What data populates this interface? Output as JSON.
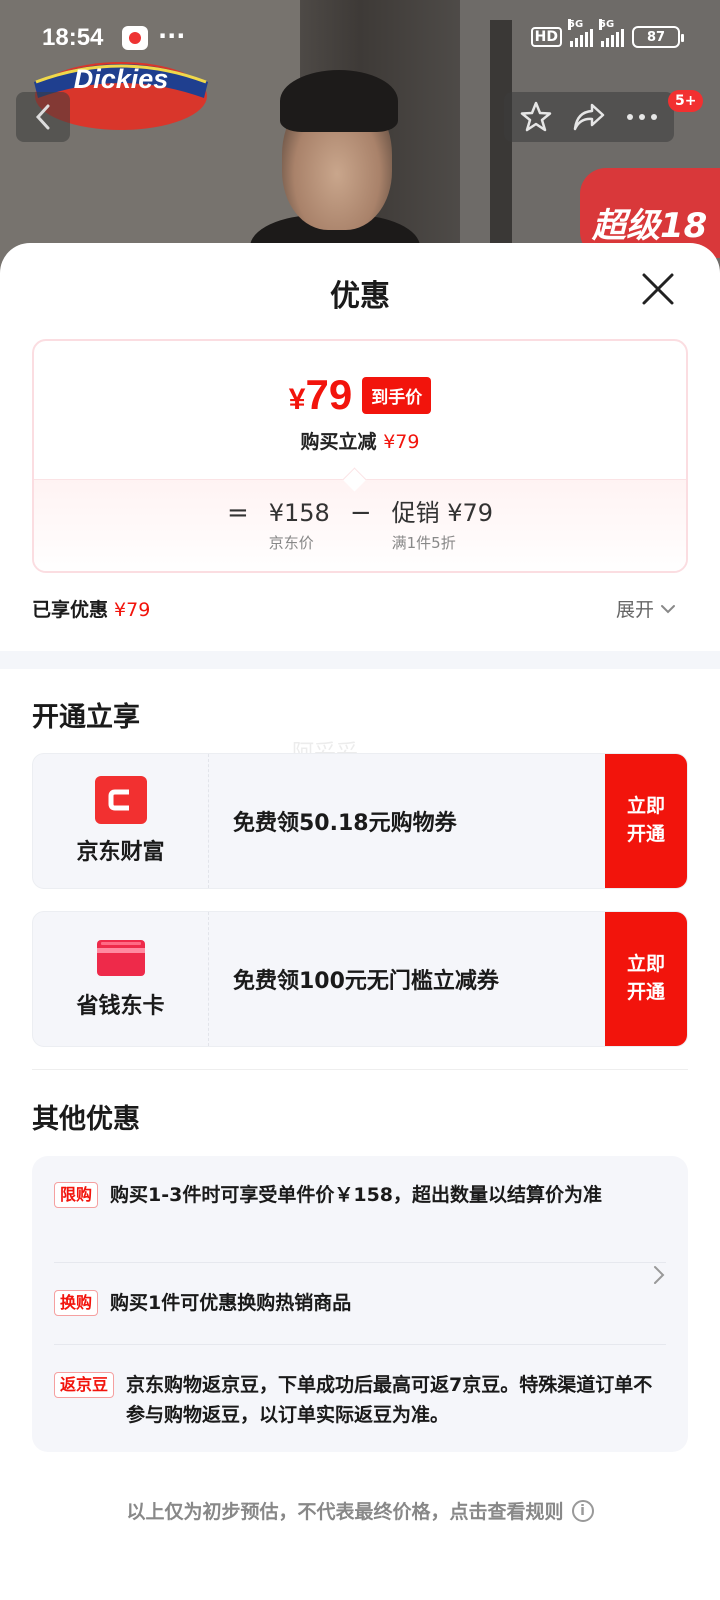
{
  "status_bar": {
    "time": "18:54",
    "dots": "···",
    "hd": "HD",
    "network_1": "5G",
    "network_2": "5G",
    "battery": "87"
  },
  "backdrop": {
    "brand_logo": "Dickies",
    "notification_badge": "5+",
    "promo_tag": "超级18"
  },
  "sheet": {
    "title": "优惠",
    "price_card": {
      "currency": "¥",
      "final_price": "79",
      "final_tag": "到手价",
      "sub_label": "购买立减",
      "sub_amount": "¥79",
      "equals": "=",
      "minus": "−",
      "base_value": "¥158",
      "base_caption": "京东价",
      "promo_value": "促销 ¥79",
      "promo_caption": "满1件5折"
    },
    "enjoyed_label": "已享优惠",
    "enjoyed_amount": "¥79",
    "expand_label": "展开",
    "watermark": "阿妥妥",
    "open_section": {
      "title": "开通立享",
      "cards": [
        {
          "name": "京东财富",
          "text": "免费领50.18元购物券",
          "button": "立即\n开通",
          "icon": "jd-finance-icon"
        },
        {
          "name": "省钱东卡",
          "text": "免费领100元无门槛立减券",
          "button": "立即\n开通",
          "icon": "card-icon"
        }
      ]
    },
    "other_section": {
      "title": "其他优惠",
      "items": [
        {
          "tag": "限购",
          "text": "购买1-3件时可享受单件价￥158，超出数量以结算价为准"
        },
        {
          "tag": "换购",
          "text": "购买1件可优惠换购热销商品"
        },
        {
          "tag": "返京豆",
          "text": "京东购物返京豆，下单成功后最高可返7京豆。特殊渠道订单不参与购物返豆，以订单实际返豆为准。"
        }
      ]
    },
    "footer_note": "以上仅为初步预估，不代表最终价格，点击查看规则",
    "info_icon": "i"
  },
  "colors": {
    "accent_red": "#f2140c",
    "card_border": "#fbdde1",
    "panel_bg": "#f5f6fa"
  }
}
